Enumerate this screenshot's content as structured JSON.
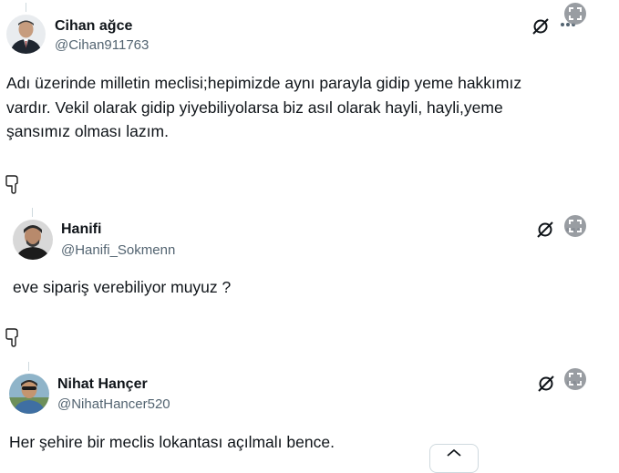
{
  "posts": [
    {
      "author": "Cihan ağce",
      "handle": "@Cihan911763",
      "text_lines": [
        "Adı üzerinde milletin meclisi;hepimizde aynı parayla gidip yeme hakkımız",
        "vardır. Vekil olarak gidip yiyebiliyolarsa biz asıl olarak hayli, hayli,yeme",
        "şansımız olması lazım."
      ]
    },
    {
      "author": "Hanifi",
      "handle": "@Hanifi_Sokmenn",
      "text_lines": [
        "eve sipariş verebiliyor muyuz ?"
      ]
    },
    {
      "author": "Nihat Hançer",
      "handle": "@NihatHancer520",
      "text_lines": [
        "Her şehire bir meclis lokantası açılmalı bence."
      ]
    }
  ],
  "icons": {
    "grok": "grok-slash-icon",
    "more": "more-dots-icon",
    "expand": "expand-icon",
    "pointer": "hand-pointing-down-icon",
    "scroll": "chevron-up-icon"
  },
  "colors": {
    "text": "#0f1419",
    "handle": "#536471",
    "border": "#cfd9de"
  }
}
